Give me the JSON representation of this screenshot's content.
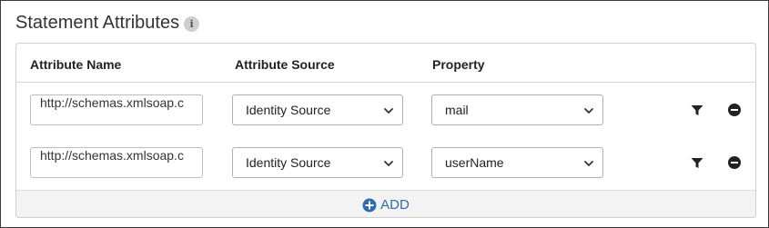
{
  "section": {
    "title": "Statement Attributes",
    "info_icon": "i"
  },
  "table": {
    "headers": {
      "attribute_name": "Attribute Name",
      "attribute_source": "Attribute Source",
      "property": "Property"
    },
    "rows": [
      {
        "attribute_name": "http://schemas.xmlsoap.c",
        "attribute_source": "Identity Source",
        "property": "mail"
      },
      {
        "attribute_name": "http://schemas.xmlsoap.c",
        "attribute_source": "Identity Source",
        "property": "userName"
      }
    ]
  },
  "footer": {
    "add_label": "ADD"
  },
  "icons": {
    "filter": "filter-icon",
    "remove": "minus-circle-icon",
    "add": "plus-circle-icon",
    "dropdown": "chevron-down-icon"
  },
  "colors": {
    "accent": "#2a6db5",
    "footer_bg": "#f3f3f3"
  }
}
